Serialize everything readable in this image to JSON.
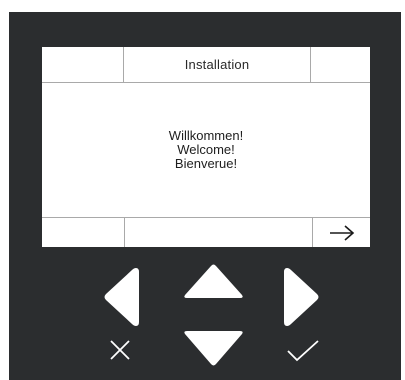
{
  "screen": {
    "title": "Installation",
    "message_lines": [
      "Willkommen!",
      "Welcome!",
      "Bienverue!"
    ]
  },
  "softkeys": {
    "next_icon": "arrow-right-icon"
  },
  "keypad": {
    "left_icon": "triangle-left-icon",
    "up_icon": "triangle-up-icon",
    "right_icon": "triangle-right-icon",
    "down_icon": "triangle-down-icon",
    "cancel_icon": "x-icon",
    "confirm_icon": "check-icon"
  },
  "colors": {
    "bezel": "#2b2d2f",
    "screen": "#ffffff",
    "divider": "#a9a9a9",
    "keys": "#ffffff"
  }
}
